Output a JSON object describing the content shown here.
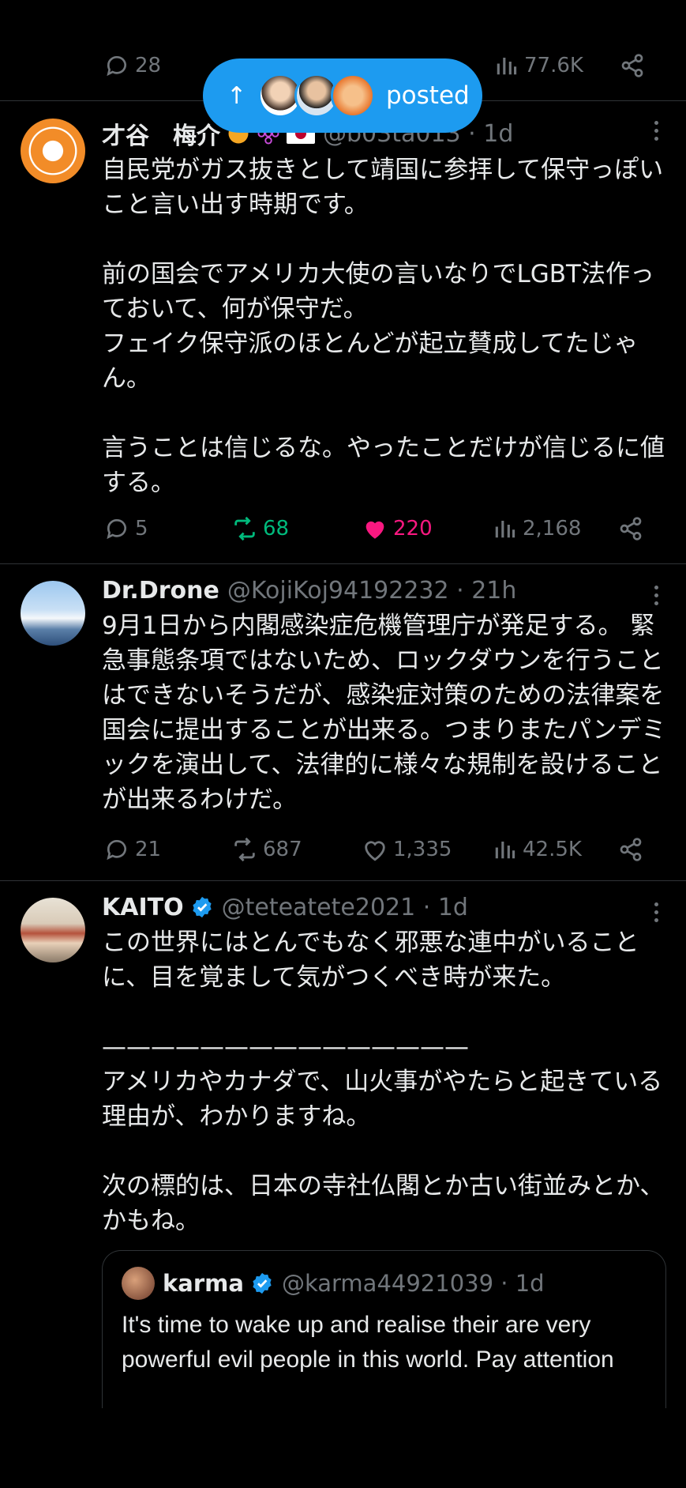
{
  "top_actions": {
    "replies": "28",
    "views": "77.6K"
  },
  "banner": {
    "label": "posted",
    "arrow": "↑"
  },
  "tweets": [
    {
      "name": "才谷　梅介",
      "handle": "@b03ta013 · 1d",
      "text": "自民党がガス抜きとして靖国に参拝して保守っぽいこと言い出す時期です。\n\n前の国会でアメリカ大使の言いなりでLGBT法作っておいて、何が保守だ。\nフェイク保守派のほとんどが起立賛成してたじゃん。\n\n言うことは信じるな。やったことだけが信じるに値する。",
      "replies": "5",
      "retweets": "68",
      "likes": "220",
      "views": "2,168"
    },
    {
      "name": "Dr.Drone",
      "handle": "@KojiKoj94192232 · 21h",
      "text": "9月1日から内閣感染症危機管理庁が発足する。 緊急事態条項ではないため、ロックダウンを行うことはできないそうだが、感染症対策のための法律案を国会に提出することが出来る。つまりまたパンデミックを演出して、法律的に様々な規制を設けることが出来るわけだ。",
      "replies": "21",
      "retweets": "687",
      "likes": "1,335",
      "views": "42.5K"
    },
    {
      "name": "KAITO",
      "handle": "@teteatete2021 · 1d",
      "text": "この世界にはとんでもなく邪悪な連中がいることに、目を覚まして気がつくべき時が来た。\n\n———————————————\nアメリカやカナダで、山火事がやたらと起きている理由が、わかりますね。\n\n次の標的は、日本の寺社仏閣とか古い街並みとか、かもね。",
      "quote": {
        "name": "karma",
        "handle": "@karma44921039 · 1d",
        "text": "It's time to wake up and realise their are very powerful evil people in this world. Pay attention"
      }
    }
  ],
  "colors": {
    "accent": "#1d9bf0",
    "like": "#f91880",
    "retweet": "#00ba7c",
    "muted": "#71767b"
  }
}
